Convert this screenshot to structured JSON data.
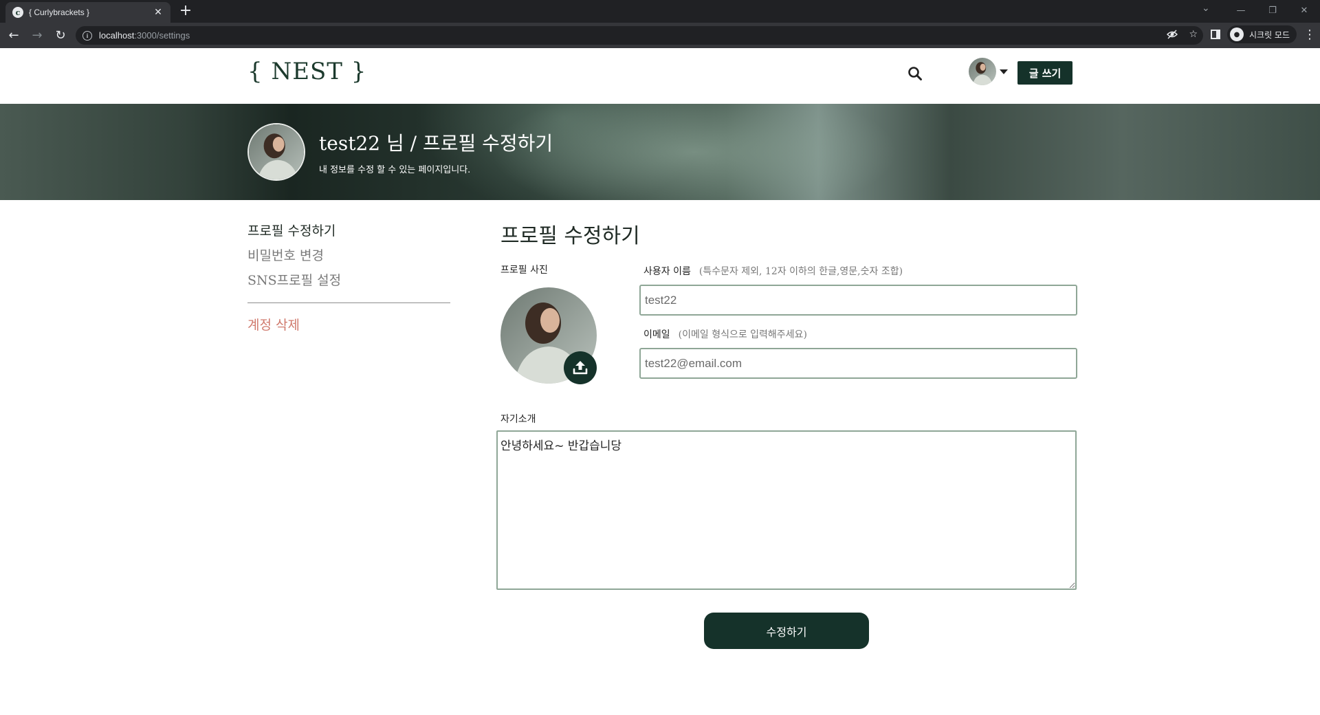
{
  "browser": {
    "tab_title": "{ Curlybrackets }",
    "tab_favicon_letter": "c",
    "new_tab_symbol": "+",
    "url_host": "localhost",
    "url_path": ":3000/settings",
    "incognito_label": "시크릿 모드"
  },
  "header": {
    "logo": "{ NEST }",
    "write_button": "글 쓰기"
  },
  "banner": {
    "title": "test22 님 / 프로필 수정하기",
    "subtitle": "내 정보를 수정 할 수 있는 페이지입니다."
  },
  "side_menu": {
    "items": [
      {
        "label": "프로필 수정하기",
        "active": true
      },
      {
        "label": "비밀번호 변경",
        "active": false
      },
      {
        "label": "SNS프로필 설정",
        "active": false
      }
    ],
    "delete_account": "계정 삭제"
  },
  "form": {
    "title": "프로필 수정하기",
    "photo_label": "프로필 사진",
    "username": {
      "label": "사용자 이름",
      "hint": "(특수문자 제외, 12자 이하의 한글,영문,숫자 조합)",
      "value": "test22"
    },
    "email": {
      "label": "이메일",
      "hint": "(이메일 형식으로 입력해주세요)",
      "value": "test22@email.com"
    },
    "bio": {
      "label": "자기소개",
      "value": "안녕하세요~ 반갑습니당"
    },
    "submit_button": "수정하기"
  },
  "colors": {
    "brand_dark": "#15322a",
    "danger": "#d07a6d",
    "input_border": "#8ea696"
  }
}
